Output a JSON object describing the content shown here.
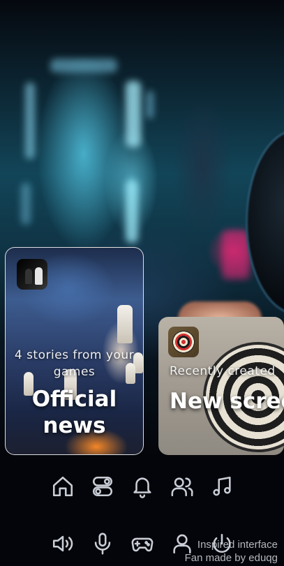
{
  "theme": {
    "background": "#04050a",
    "icon_color": "#c9cdd6",
    "text_color": "#ffffff"
  },
  "cards": {
    "news": {
      "subtitle": "4 stories from your games",
      "title": "Official news",
      "app_icon": "chess-app-icon"
    },
    "screenshots": {
      "subtitle": "Recently created",
      "title": "New screenshots",
      "app_icon": "darts-app-icon"
    }
  },
  "nav": {
    "row1": [
      "home-icon",
      "toggles-icon",
      "bell-icon",
      "users-icon",
      "music-icon"
    ],
    "row2": [
      "volume-icon",
      "microphone-icon",
      "gamepad-icon",
      "user-icon",
      "power-icon"
    ]
  },
  "credits": {
    "line1": "Inspired interface",
    "line2": "Fan made by eduqg"
  }
}
